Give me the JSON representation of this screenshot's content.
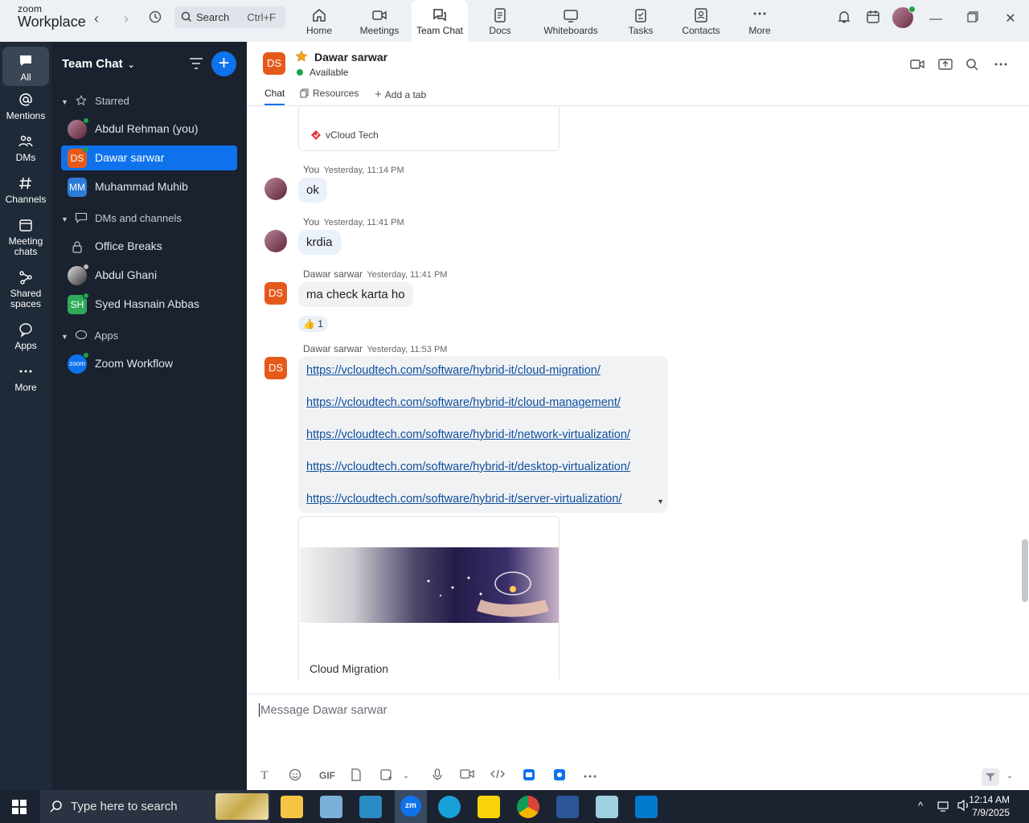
{
  "app": {
    "logo_top": "zoom",
    "logo_bottom": "Workplace"
  },
  "search": {
    "label": "Search",
    "shortcut": "Ctrl+F"
  },
  "tabs": [
    {
      "label": "Home"
    },
    {
      "label": "Meetings"
    },
    {
      "label": "Team Chat"
    },
    {
      "label": "Docs"
    },
    {
      "label": "Whiteboards"
    },
    {
      "label": "Tasks"
    },
    {
      "label": "Contacts"
    },
    {
      "label": "More"
    }
  ],
  "rail": [
    {
      "label": "All"
    },
    {
      "label": "Mentions"
    },
    {
      "label": "DMs"
    },
    {
      "label": "Channels"
    },
    {
      "label": "Meeting chats"
    },
    {
      "label": "Shared spaces"
    },
    {
      "label": "Apps"
    },
    {
      "label": "More"
    }
  ],
  "sidebar": {
    "title": "Team Chat",
    "starred_header": "Starred",
    "dms_header": "DMs and channels",
    "apps_header": "Apps",
    "items": [
      {
        "label": "Abdul Rehman (you)"
      },
      {
        "label": "Dawar sarwar",
        "initials": "DS"
      },
      {
        "label": "Muhammad Muhib",
        "initials": "MM"
      },
      {
        "label": "Office Breaks"
      },
      {
        "label": "Abdul Ghani"
      },
      {
        "label": "Syed Hasnain Abbas",
        "initials": "SH"
      },
      {
        "label": "Zoom Workflow",
        "initials": "zoom"
      }
    ]
  },
  "header": {
    "initials": "DS",
    "name": "Dawar sarwar",
    "status": "Available",
    "tabs": {
      "chat": "Chat",
      "resources": "Resources",
      "add": "Add a tab"
    }
  },
  "messages": {
    "card_source": "vCloud Tech",
    "m1": {
      "author": "You",
      "time": "Yesterday, 11:14 PM",
      "text": "ok"
    },
    "m2": {
      "author": "You",
      "time": "Yesterday, 11:41 PM",
      "text": "krdia"
    },
    "m3": {
      "author": "Dawar sarwar",
      "time": "Yesterday, 11:41 PM",
      "text": "ma check karta ho",
      "reaction": "1",
      "initials": "DS"
    },
    "m4": {
      "author": "Dawar sarwar",
      "time": "Yesterday, 11:53 PM",
      "initials": "DS",
      "links": [
        "https://vcloudtech.com/software/hybrid-it/cloud-migration/",
        "https://vcloudtech.com/software/hybrid-it/cloud-management/",
        "https://vcloudtech.com/software/hybrid-it/network-virtualization/",
        "https://vcloudtech.com/software/hybrid-it/desktop-virtualization/",
        "https://vcloudtech.com/software/hybrid-it/server-virtualization/"
      ]
    },
    "preview_title": "Cloud Migration"
  },
  "composer": {
    "placeholder": "Message Dawar sarwar",
    "gif": "GIF"
  },
  "taskbar": {
    "search_placeholder": "Type here to search",
    "time": "12:14 AM",
    "date": "7/9/2025"
  },
  "colors": {
    "accent": "#0e72ed",
    "rail": "#1f2a38",
    "sidebar": "#1a2230",
    "ds_badge": "#e55a1b",
    "online": "#1ea446"
  }
}
